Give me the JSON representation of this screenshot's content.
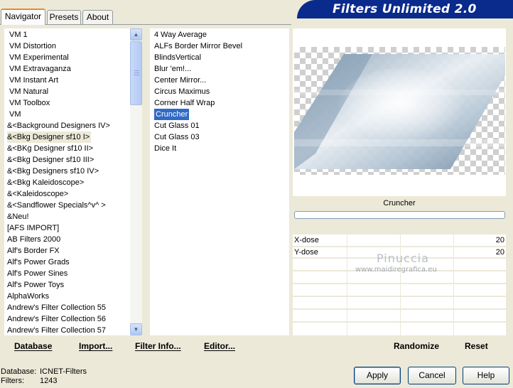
{
  "tabs": [
    "Navigator",
    "Presets",
    "About"
  ],
  "title": "Filters Unlimited 2.0",
  "categories": [
    "VM 1",
    "VM Distortion",
    "VM Experimental",
    "VM Extravaganza",
    "VM Instant Art",
    "VM Natural",
    "VM Toolbox",
    "VM",
    "&<Background Designers IV>",
    "&<Bkg Designer sf10 I>",
    "&<BKg Designer sf10 II>",
    "&<Bkg Designer sf10 III>",
    "&<Bkg Designers sf10 IV>",
    "&<Bkg Kaleidoscope>",
    "&<Kaleidoscope>",
    "&<Sandflower Specials^v^ >",
    "&Neu!",
    "[AFS IMPORT]",
    "AB Filters 2000",
    "Alf's Border FX",
    "Alf's Power Grads",
    "Alf's Power Sines",
    "Alf's Power Toys",
    "AlphaWorks",
    "Andrew's Filter Collection 55",
    "Andrew's Filter Collection 56",
    "Andrew's Filter Collection 57"
  ],
  "selected_category_index": 9,
  "filters": [
    "4 Way Average",
    "ALFs Border Mirror Bevel",
    "BlindsVertical",
    "Blur 'em!...",
    "Center Mirror...",
    "Circus Maximus",
    "Corner Half Wrap",
    "Cruncher",
    "Cut Glass 01",
    "Cut Glass 03",
    "Dice It"
  ],
  "selected_filter_index": 7,
  "preview_filter_name": "Cruncher",
  "watermark": {
    "line1": "Pinuccia",
    "line2": "www.maidiregrafica.eu"
  },
  "params": [
    {
      "label": "X-dose",
      "value": "20"
    },
    {
      "label": "Y-dose",
      "value": "20"
    }
  ],
  "toolbar": {
    "database": "Database",
    "import": "Import...",
    "filter_info": "Filter Info...",
    "editor": "Editor...",
    "randomize": "Randomize",
    "reset": "Reset"
  },
  "status": {
    "database_label": "Database:",
    "database_value": "ICNET-Filters",
    "filters_label": "Filters:",
    "filters_value": "1243"
  },
  "buttons": {
    "apply": "Apply",
    "cancel": "Cancel",
    "help": "Help"
  },
  "colors": {
    "banner": "#0a2a8c",
    "selection": "#316ac5",
    "window": "#ece9d8"
  }
}
